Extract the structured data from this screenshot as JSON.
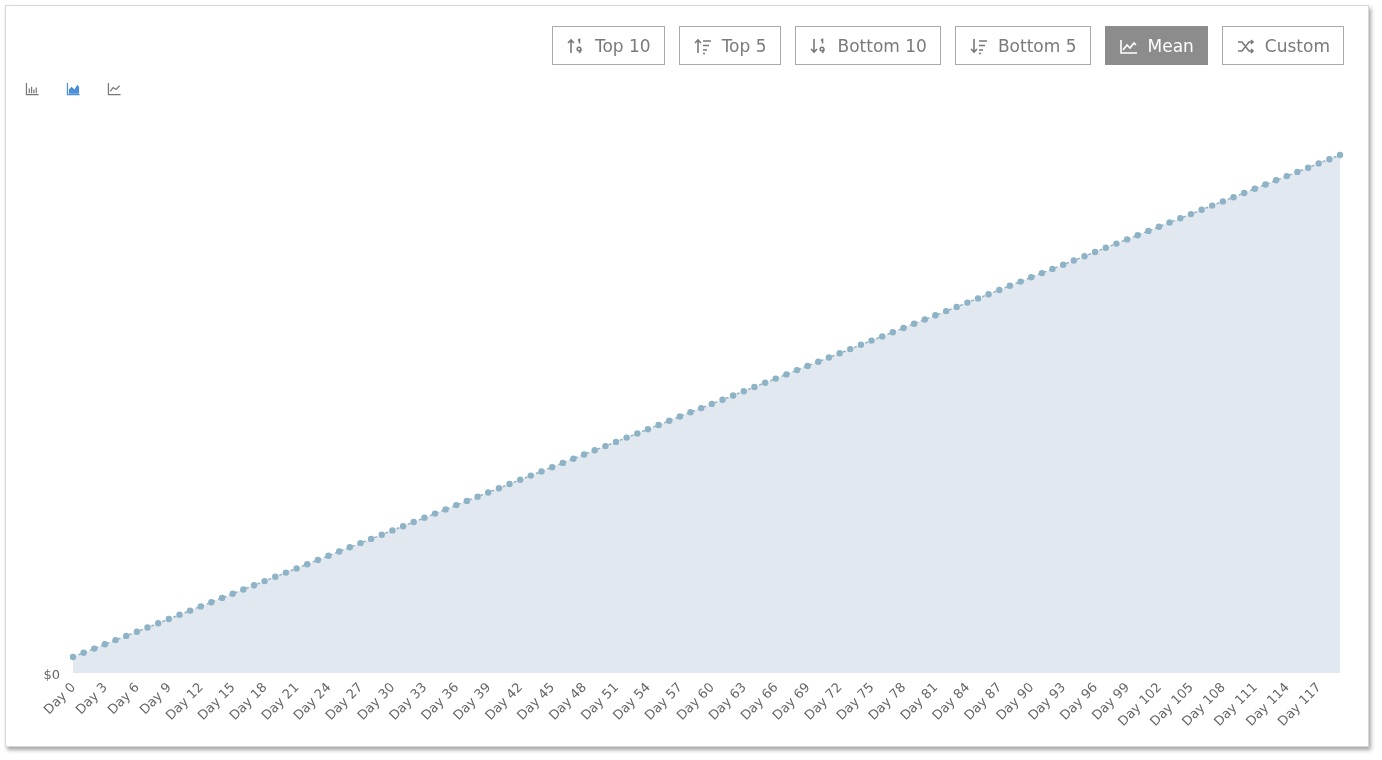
{
  "toolbar": [
    {
      "label": "Top 10",
      "kind": "sort-desc-numeric",
      "selected": false
    },
    {
      "label": "Top 5",
      "kind": "sort-desc-lines",
      "selected": false
    },
    {
      "label": "Bottom 10",
      "kind": "sort-asc-numeric",
      "selected": false
    },
    {
      "label": "Bottom 5",
      "kind": "sort-asc-lines",
      "selected": false
    },
    {
      "label": "Mean",
      "kind": "mean",
      "selected": true
    },
    {
      "label": "Custom",
      "kind": "shuffle",
      "selected": false
    }
  ],
  "chart_types": [
    {
      "kind": "bar",
      "selected": false
    },
    {
      "kind": "area",
      "selected": true
    },
    {
      "kind": "line",
      "selected": false
    }
  ],
  "chart": {
    "y_label": "$0",
    "x_labels": [
      "Day 0",
      "Day 3",
      "Day 6",
      "Day 9",
      "Day 12",
      "Day 15",
      "Day 18",
      "Day 21",
      "Day 24",
      "Day 27",
      "Day 30",
      "Day 33",
      "Day 36",
      "Day 39",
      "Day 42",
      "Day 45",
      "Day 48",
      "Day 51",
      "Day 54",
      "Day 57",
      "Day 60",
      "Day 63",
      "Day 66",
      "Day 69",
      "Day 72",
      "Day 75",
      "Day 78",
      "Day 81",
      "Day 84",
      "Day 87",
      "Day 90",
      "Day 93",
      "Day 96",
      "Day 99",
      "Day 102",
      "Day 105",
      "Day 108",
      "Day 111",
      "Day 114",
      "Day 117"
    ]
  }
}
